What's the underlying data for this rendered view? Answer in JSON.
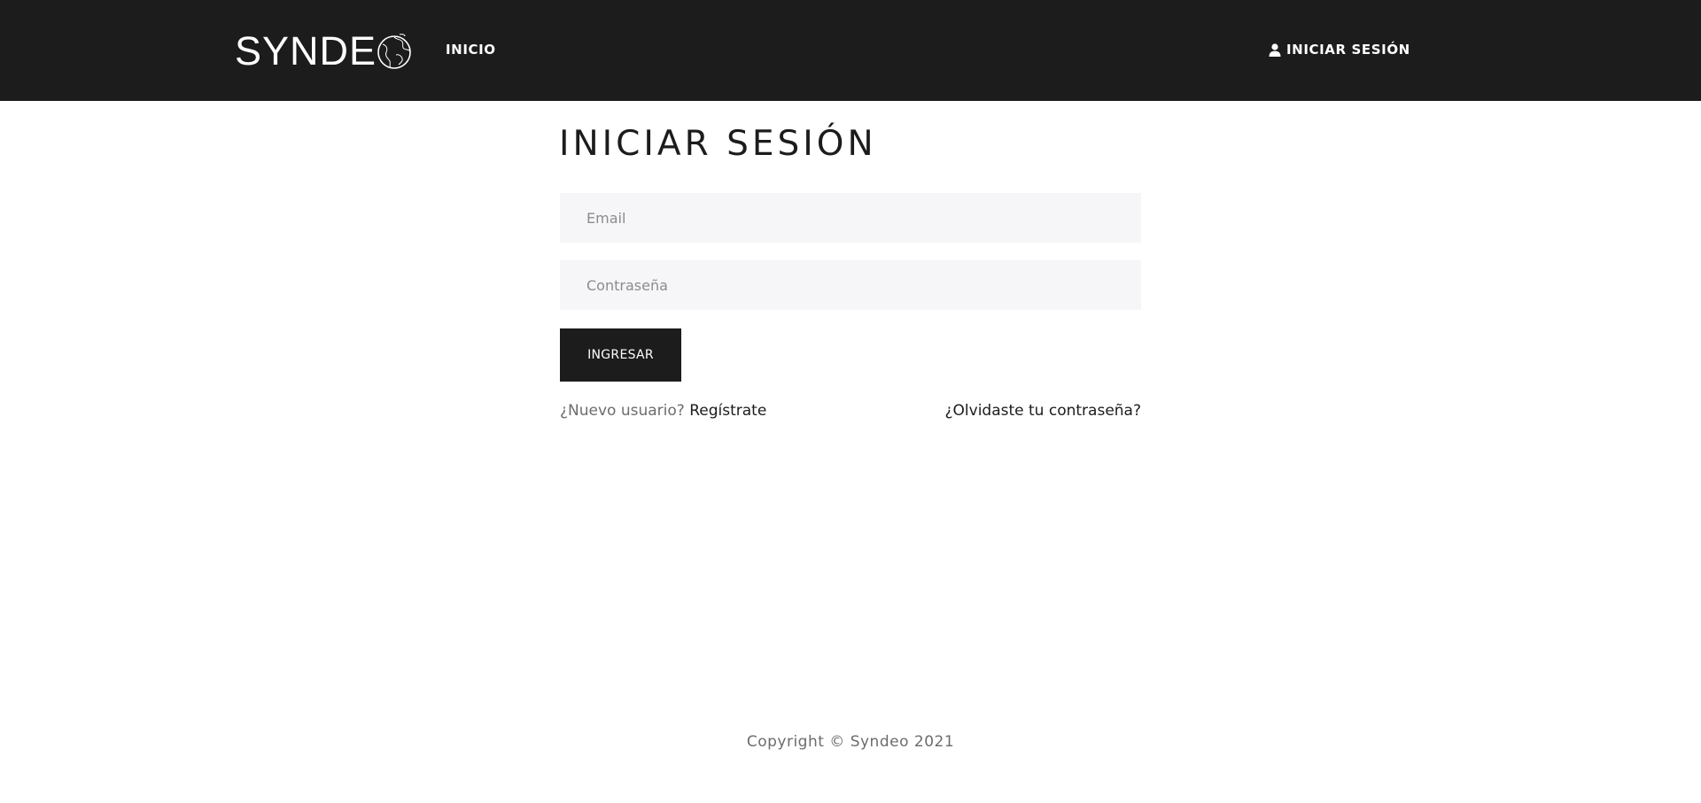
{
  "navbar": {
    "logo_text": "SYNDE",
    "home_label": "INICIO",
    "login_label": "INICIAR SESIÓN",
    "background": "#1c1c1c",
    "text_color": "#ffffff"
  },
  "icons": {
    "logo": "globe-icon",
    "login": "user-icon"
  },
  "page": {
    "title": "INICIAR SESIÓN"
  },
  "form": {
    "email_placeholder": "Email",
    "password_placeholder": "Contraseña",
    "submit_label": "INGRESAR",
    "field_background": "#f6f6f8",
    "button_background": "#1c1c1c"
  },
  "links": {
    "new_user_prefix": "¿Nuevo usuario? ",
    "register_label": "Regístrate",
    "forgot_label": "¿Olvidaste tu contraseña?"
  },
  "footer": {
    "copyright": "Copyright © Syndeo 2021"
  }
}
